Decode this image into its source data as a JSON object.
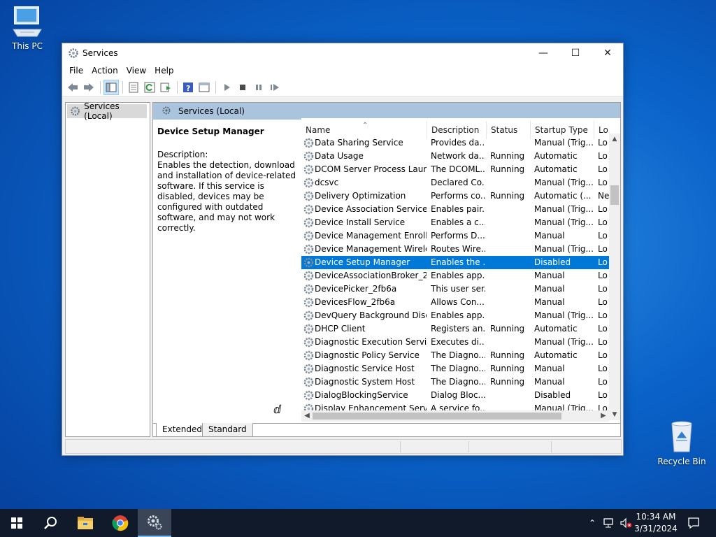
{
  "desktop": {
    "this_pc_label": "This PC",
    "recycle_bin_label": "Recycle Bin"
  },
  "window": {
    "title": "Services",
    "menu": [
      "File",
      "Action",
      "View",
      "Help"
    ]
  },
  "tree": {
    "root_label": "Services (Local)"
  },
  "pane": {
    "header_label": "Services (Local)",
    "selected_service_title": "Device Setup Manager",
    "description_label": "Description:",
    "description_text": "Enables the detection, download and installation of device-related software. If this service is disabled, devices may be configured with outdated software, and may not work correctly."
  },
  "list": {
    "columns": [
      "Name",
      "Description",
      "Status",
      "Startup Type",
      "Lo"
    ],
    "rows": [
      {
        "name": "Data Sharing Service",
        "desc": "Provides da...",
        "status": "",
        "startup": "Manual (Trig...",
        "logon": "Lo"
      },
      {
        "name": "Data Usage",
        "desc": "Network da...",
        "status": "Running",
        "startup": "Automatic",
        "logon": "Lo"
      },
      {
        "name": "DCOM Server Process Laun...",
        "desc": "The DCOML...",
        "status": "Running",
        "startup": "Automatic",
        "logon": "Lo"
      },
      {
        "name": "dcsvc",
        "desc": "Declared Co...",
        "status": "",
        "startup": "Manual (Trig...",
        "logon": "Lo"
      },
      {
        "name": "Delivery Optimization",
        "desc": "Performs co...",
        "status": "Running",
        "startup": "Automatic (...",
        "logon": "Ne"
      },
      {
        "name": "Device Association Service",
        "desc": "Enables pair...",
        "status": "",
        "startup": "Manual (Trig...",
        "logon": "Lo"
      },
      {
        "name": "Device Install Service",
        "desc": "Enables a c...",
        "status": "",
        "startup": "Manual (Trig...",
        "logon": "Lo"
      },
      {
        "name": "Device Management Enroll...",
        "desc": "Performs D...",
        "status": "",
        "startup": "Manual",
        "logon": "Lo"
      },
      {
        "name": "Device Management Wirele...",
        "desc": "Routes Wire...",
        "status": "",
        "startup": "Manual (Trig...",
        "logon": "Lo"
      },
      {
        "name": "Device Setup Manager",
        "desc": "Enables the ...",
        "status": "",
        "startup": "Disabled",
        "logon": "Lo"
      },
      {
        "name": "DeviceAssociationBroker_2f...",
        "desc": "Enables app...",
        "status": "",
        "startup": "Manual",
        "logon": "Lo"
      },
      {
        "name": "DevicePicker_2fb6a",
        "desc": "This user ser...",
        "status": "",
        "startup": "Manual",
        "logon": "Lo"
      },
      {
        "name": "DevicesFlow_2fb6a",
        "desc": "Allows Con...",
        "status": "",
        "startup": "Manual",
        "logon": "Lo"
      },
      {
        "name": "DevQuery Background Disc...",
        "desc": "Enables app...",
        "status": "",
        "startup": "Manual (Trig...",
        "logon": "Lo"
      },
      {
        "name": "DHCP Client",
        "desc": "Registers an...",
        "status": "Running",
        "startup": "Automatic",
        "logon": "Lo"
      },
      {
        "name": "Diagnostic Execution Service",
        "desc": "Executes di...",
        "status": "",
        "startup": "Manual (Trig...",
        "logon": "Lo"
      },
      {
        "name": "Diagnostic Policy Service",
        "desc": "The Diagno...",
        "status": "Running",
        "startup": "Automatic",
        "logon": "Lo"
      },
      {
        "name": "Diagnostic Service Host",
        "desc": "The Diagno...",
        "status": "Running",
        "startup": "Manual",
        "logon": "Lo"
      },
      {
        "name": "Diagnostic System Host",
        "desc": "The Diagno...",
        "status": "Running",
        "startup": "Manual",
        "logon": "Lo"
      },
      {
        "name": "DialogBlockingService",
        "desc": "Dialog Bloc...",
        "status": "",
        "startup": "Disabled",
        "logon": "Lo"
      },
      {
        "name": "Display Enhancement Service",
        "desc": "A service fo...",
        "status": "",
        "startup": "Manual (Trig...",
        "logon": "Lo"
      }
    ],
    "selected_index": 9
  },
  "tabs": [
    "Extended",
    "Standard"
  ],
  "taskbar": {
    "time": "10:34 AM",
    "date": "3/31/2024"
  },
  "colors": {
    "selection": "#0078d7",
    "pane_header": "#aac4de",
    "taskbar": "#101a2a"
  }
}
